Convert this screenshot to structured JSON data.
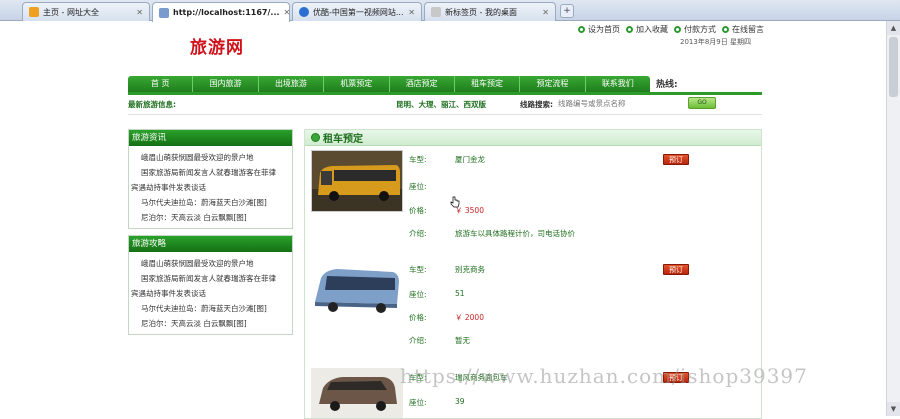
{
  "browser": {
    "tabs": [
      {
        "title": "主页 - 网址大全",
        "active": false
      },
      {
        "title": "http://localhost:1167/...",
        "active": true
      },
      {
        "title": "优酷-中国第一视频网站...",
        "active": false
      },
      {
        "title": "新标签页 - 我的桌面",
        "active": false
      }
    ],
    "new_tab": "+"
  },
  "header": {
    "logo": "旅游网",
    "links": [
      "设为首页",
      "加入收藏",
      "付款方式",
      "在线留言"
    ],
    "date": "2013年8月9日   星期四",
    "hotline_label": "热线:"
  },
  "nav": {
    "items": [
      "首 页",
      "国内旅游",
      "出境旅游",
      "机票预定",
      "酒店预定",
      "租车预定",
      "预定流程",
      "联系我们"
    ]
  },
  "subnav": {
    "latest_label": "最新旅游信息:",
    "destinations": "昆明、大理、丽江、西双版",
    "search_label": "线路搜索:",
    "search_placeholder": "线路编号或景点名称",
    "go_label": "GO"
  },
  "sidebar": {
    "news": {
      "title": "旅游资讯",
      "items": [
        "峨眉山萌获悯圆最受欢迎的景户地",
        "国家旅游局新闻发言人就春瑞游客在菲律",
        "宾遇劫持事件发表谈话",
        "马尔代夫迪拉岛：蔚海蓝天白沙滩[图]",
        "尼泊尔：天高云淡  白云飘飘[图]"
      ]
    },
    "guide": {
      "title": "旅游攻略",
      "items": [
        "峨眉山萌获悯圆最受欢迎的景户地",
        "国家旅游局新闻发言人就春瑞游客在菲律",
        "宾遇劫持事件发表谈话",
        "马尔代夫迪拉岛：蔚海蓝天白沙滩[图]",
        "尼泊尔：天高云淡  白云飘飘[图]"
      ]
    }
  },
  "main": {
    "title": "租车预定",
    "labels": {
      "model": "车型:",
      "seats": "座位:",
      "price": "价格:",
      "intro": "介绍:"
    },
    "book_label": "预订",
    "cars": [
      {
        "model": "厦门金龙",
        "seats": "",
        "price": "￥ 3500",
        "intro": "旅游车以具体路程计价，司电话协价"
      },
      {
        "model": "别克商务",
        "seats": "51",
        "price": "￥ 2000",
        "intro": "暂无"
      },
      {
        "model": "瑞风商务面包车",
        "seats": "39",
        "price": "",
        "intro": ""
      }
    ]
  },
  "watermark": "https://www.huzhan.com/ishop39397"
}
